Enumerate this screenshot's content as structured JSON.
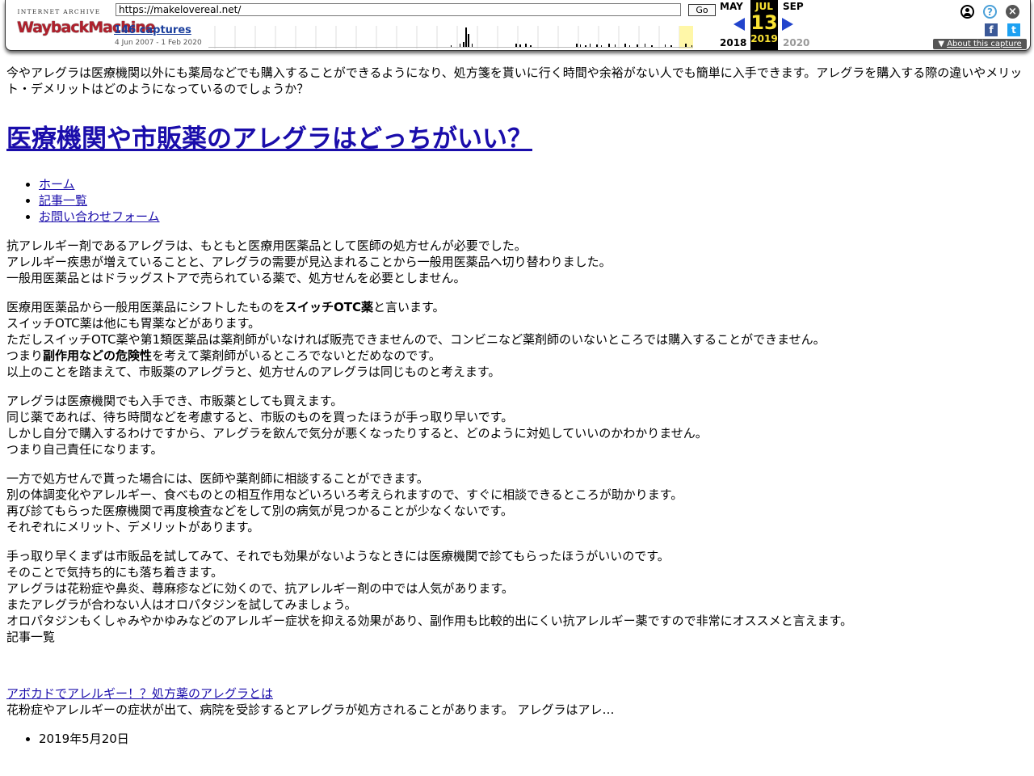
{
  "wayback": {
    "logo_small": "INTERNET ARCHIVE",
    "logo_main": "WaybackMachine",
    "url": "https://makelovereal.net/",
    "go_label": "Go",
    "captures": "146 captures",
    "range": "4 Jun 2007 - 1 Feb 2020",
    "month_prev": "MAY",
    "month_current": "JUL",
    "month_next": "SEP",
    "day": "13",
    "year_prev": "2018",
    "year_current": "2019",
    "year_next": "2020",
    "about": "About this capture",
    "icons": [
      "user-icon",
      "help-icon",
      "close-icon",
      "facebook-icon",
      "twitter-icon"
    ],
    "colors": {
      "accent_yellow": "#f9e233",
      "arrow_blue": "#2244cc",
      "link_blue": "#1b3f9d"
    }
  },
  "page": {
    "intro": "今やアレグラは医療機関以外にも薬局などでも購入することができるようになり、処方箋を貰いに行く時間や余裕がない人でも簡単に入手できます。アレグラを購入する際の違いやメリット・デメリットはどのようになっているのでしょうか？",
    "site_title": "医療機関や市販薬のアレグラはどっちがいい？",
    "nav": [
      "ホーム",
      "記事一覧",
      "お問い合わせフォーム"
    ],
    "p1": [
      "抗アレルギー剤であるアレグラは、もともと医療用医薬品として医師の処方せんが必要でした。",
      "アレルギー疾患が増えていることと、アレグラの需要が見込まれることから一般用医薬品へ切り替わりました。",
      "一般用医薬品とはドラッグストアで売られている薬で、処方せんを必要としません。"
    ],
    "p2_l1_a": "医療用医薬品から一般用医薬品にシフトしたものを",
    "p2_l1_b": "スイッチOTC薬",
    "p2_l1_c": "と言います。",
    "p2_l2": "スイッチOTC薬は他にも胃薬などがあります。",
    "p2_l3": "ただしスイッチOTC薬や第1類医薬品は薬剤師がいなければ販売できませんので、コンビニなど薬剤師のいないところでは購入することができません。",
    "p2_l4_a": "つまり",
    "p2_l4_b": "副作用などの危険性",
    "p2_l4_c": "を考えて薬剤師がいるところでないとだめなのです。",
    "p2_l5": "以上のことを踏まえて、市販薬のアレグラと、処方せんのアレグラは同じものと考えます。",
    "p3": [
      "アレグラは医療機関でも入手でき、市販薬としても買えます。",
      "同じ薬であれば、待ち時間などを考慮すると、市販のものを買ったほうが手っ取り早いです。",
      "しかし自分で購入するわけですから、アレグラを飲んで気分が悪くなったりすると、どのように対処していいのかわかりません。",
      "つまり自己責任になります。"
    ],
    "p4": [
      "一方で処方せんで貰った場合には、医師や薬剤師に相談することができます。",
      "別の体調変化やアレルギー、食べものとの相互作用などいろいろ考えられますので、すぐに相談できるところが助かります。",
      "再び診てもらった医療機関で再度検査などをして別の病気が見つかることが少なくないです。",
      "それぞれにメリット、デメリットがあります。"
    ],
    "p5": [
      "手っ取り早くまずは市販品を試してみて、それでも効果がないようなときには医療機関で診てもらったほうがいいのです。",
      "そのことで気持ち的にも落ち着きます。",
      "アレグラは花粉症や鼻炎、蕁麻疹などに効くので、抗アレルギー剤の中では人気があります。",
      "またアレグラが合わない人はオロパタジンを試してみましょう。",
      "オロパタジンもくしゃみやかゆみなどのアレルギー症状を抑える効果があり、副作用も比較的出にくい抗アレルギー薬ですので非常にオススメと言えます。"
    ],
    "list_heading": "記事一覧",
    "post_title": "アボカドでアレルギー！？処方薬のアレグラとは",
    "post_excerpt": "花粉症やアレルギーの症状が出て、病院を受診するとアレグラが処方されることがあります。 アレグラはアレ…",
    "post_date": "2019年5月20日"
  }
}
